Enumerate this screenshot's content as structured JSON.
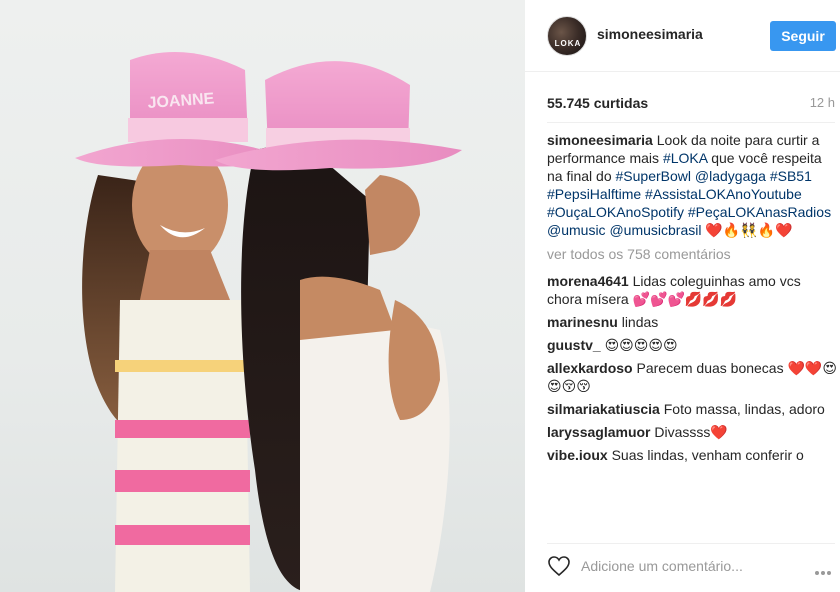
{
  "photo": {
    "alt": "",
    "hat_text": "JOANNE"
  },
  "post": {
    "username": "simoneesimaria",
    "avatar_badge": "LOKA",
    "follow_label": "Seguir",
    "likes": "55.745 curtidas",
    "time": "12 h"
  },
  "caption": {
    "user": "simoneesimaria",
    "parts": [
      {
        "text": "Look da noite para curtir a performance mais ",
        "tag": false
      },
      {
        "text": "#LOKA",
        "tag": true
      },
      {
        "text": " que você respeita na final do ",
        "tag": false
      },
      {
        "text": "#SuperBowl",
        "tag": true
      },
      {
        "text": " ",
        "tag": false
      },
      {
        "text": "@ladygaga",
        "tag": true
      },
      {
        "text": " ",
        "tag": false
      },
      {
        "text": "#SB51",
        "tag": true
      },
      {
        "text": " ",
        "tag": false
      },
      {
        "text": "#PepsiHalftime",
        "tag": true
      },
      {
        "text": " ",
        "tag": false
      },
      {
        "text": "#AssistaLOKAnoYoutube",
        "tag": true
      },
      {
        "text": " ",
        "tag": false
      },
      {
        "text": "#OuçaLOKAnoSpotify",
        "tag": true
      },
      {
        "text": " ",
        "tag": false
      },
      {
        "text": "#PeçaLOKAnasRadios",
        "tag": true
      },
      {
        "text": " ",
        "tag": false
      },
      {
        "text": "@umusic",
        "tag": true
      },
      {
        "text": " ",
        "tag": false
      },
      {
        "text": "@umusicbrasil",
        "tag": true
      },
      {
        "text": " ❤️🔥👯🔥❤️",
        "tag": false
      }
    ]
  },
  "view_all": "ver todos os 758 comentários",
  "comments": [
    {
      "user": "morena4641",
      "text": "Lidas coleguinhas amo vcs chora mísera 💕💕💕💋💋💋"
    },
    {
      "user": "marinesnu",
      "text": "lindas"
    },
    {
      "user": "guustv_",
      "text": "😍😍😍😍😍"
    },
    {
      "user": "allexkardoso",
      "text": "Parecem duas bonecas ❤️❤️😍😍😚😚"
    },
    {
      "user": "silmariakatiuscia",
      "text": "Foto massa, lindas, adoro"
    },
    {
      "user": "laryssaglamuor",
      "text": "Divassss❤️"
    },
    {
      "user": "vibe.ioux",
      "text": "Suas lindas, venham conferir o"
    }
  ],
  "add_comment": {
    "placeholder": "Adicione um comentário..."
  },
  "colors": {
    "accent": "#3897f0",
    "hashtag": "#003569",
    "muted": "#999999"
  },
  "icons": {
    "like": "heart-outline-icon",
    "more": "more-options-icon"
  }
}
